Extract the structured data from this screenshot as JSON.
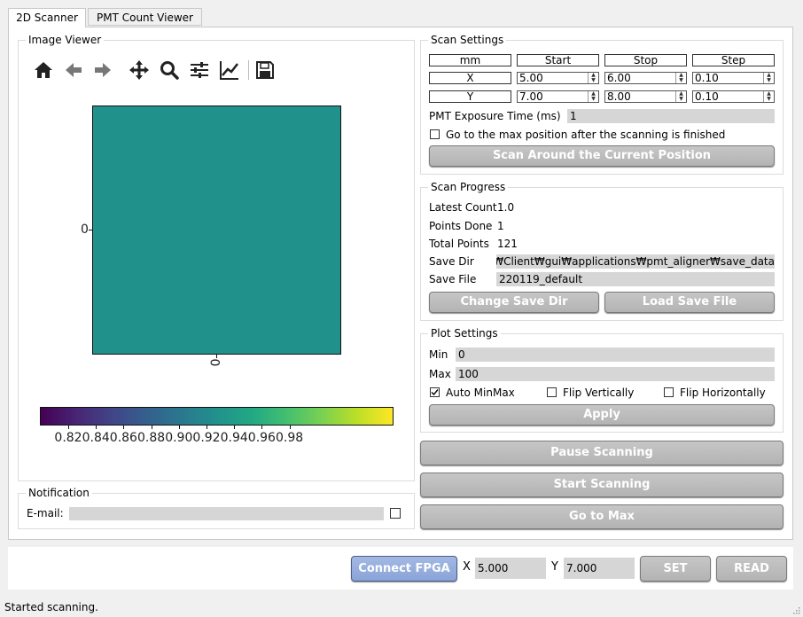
{
  "tabs": [
    {
      "label": "2D Scanner",
      "active": true
    },
    {
      "label": "PMT Count Viewer",
      "active": false
    }
  ],
  "image_viewer": {
    "title": "Image Viewer",
    "toolbar": [
      "home-icon",
      "back-arrow-icon",
      "forward-arrow-icon",
      "pan-icon",
      "zoom-icon",
      "configure-subplots-icon",
      "edit-axis-icon",
      "save-icon"
    ],
    "y_tick": "0",
    "x_tick": "0",
    "image_color": "#21918c",
    "colorbar_ticks": [
      "0.82",
      "0.84",
      "0.86",
      "0.88",
      "0.90",
      "0.92",
      "0.94",
      "0.96",
      "0.98"
    ]
  },
  "notification": {
    "title": "Notification",
    "email_label": "E-mail:",
    "email_value": "",
    "enabled": false
  },
  "scan_settings": {
    "title": "Scan Settings",
    "headers": [
      "mm",
      "Start",
      "Stop",
      "Step"
    ],
    "rows": [
      {
        "axis": "X",
        "start": "5.00",
        "stop": "6.00",
        "step": "0.10"
      },
      {
        "axis": "Y",
        "start": "7.00",
        "stop": "8.00",
        "step": "0.10"
      }
    ],
    "exposure_label": "PMT Exposure Time (ms)",
    "exposure_value": "1",
    "goto_max_label": "Go to the max position after the scanning is finished",
    "goto_max_checked": false,
    "scan_around_label": "Scan Around the Current Position"
  },
  "scan_progress": {
    "title": "Scan Progress",
    "latest_count_label": "Latest Count",
    "latest_count": "1.0",
    "points_done_label": "Points Done",
    "points_done": "1",
    "total_points_label": "Total Points",
    "total_points": "121",
    "save_dir_label": "Save Dir",
    "save_dir": "ver₩Client₩gui₩applications₩pmt_aligner₩save_data",
    "save_file_label": "Save File",
    "save_file": "220119_default",
    "change_dir_label": "Change Save Dir",
    "load_file_label": "Load Save File"
  },
  "plot_settings": {
    "title": "Plot Settings",
    "min_label": "Min",
    "min_value": "0",
    "max_label": "Max",
    "max_value": "100",
    "auto_minmax_label": "Auto MinMax",
    "auto_minmax_checked": true,
    "flip_v_label": "Flip Vertically",
    "flip_v_checked": false,
    "flip_h_label": "Flip Horizontally",
    "flip_h_checked": false,
    "apply_label": "Apply"
  },
  "actions": {
    "pause": "Pause Scanning",
    "start": "Start Scanning",
    "goto_max": "Go to Max"
  },
  "bottom_bar": {
    "connect_label": "Connect FPGA",
    "x_label": "X",
    "x_value": "5.000",
    "y_label": "Y",
    "y_value": "7.000",
    "set_label": "SET",
    "read_label": "READ"
  },
  "status_text": "Started scanning."
}
